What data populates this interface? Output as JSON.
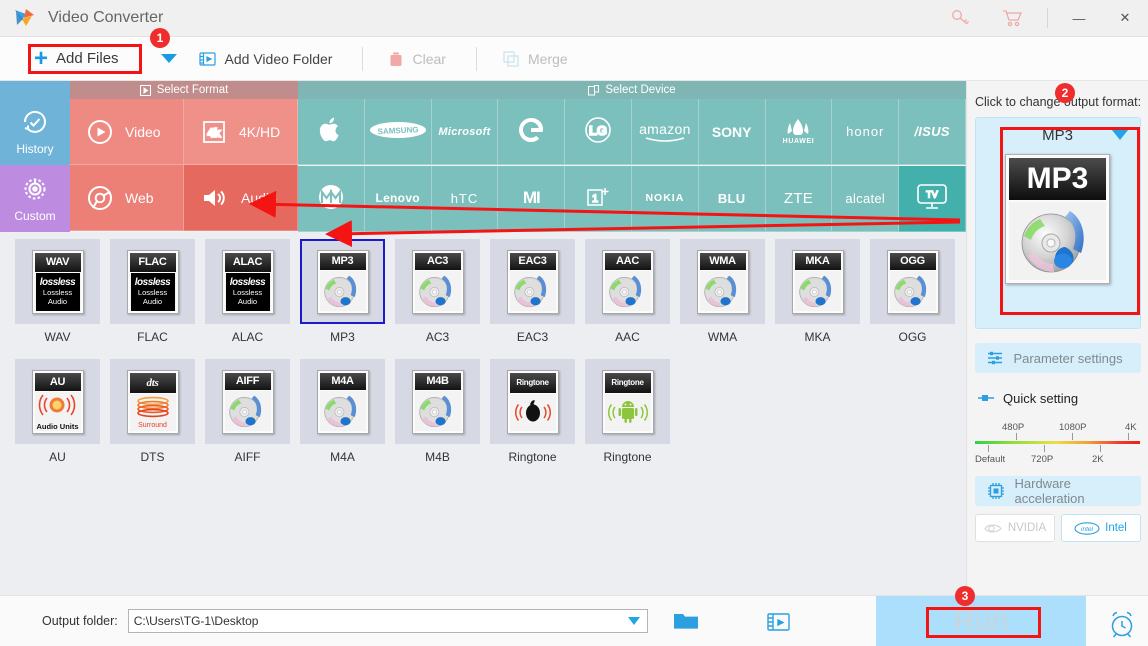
{
  "window": {
    "title": "Video Converter",
    "controls": {
      "key_icon": "key-icon",
      "cart_icon": "cart-icon",
      "minimize": "—",
      "close": "✕"
    }
  },
  "toolbar": {
    "add_files": "Add Files",
    "add_files_dropdown": "chevron-down-icon",
    "add_video_folder": "Add Video Folder",
    "clear": "Clear",
    "merge": "Merge"
  },
  "strips": {
    "select_format": "Select Format",
    "select_device": "Select Device"
  },
  "rail": [
    {
      "label": "History",
      "icon": "history-icon"
    },
    {
      "label": "Custom",
      "icon": "gear-icon"
    }
  ],
  "format_categories": [
    {
      "label": "Video",
      "icon": "play-icon"
    },
    {
      "label": "4K/HD",
      "icon": "4k-icon"
    },
    {
      "label": "Web",
      "icon": "chrome-icon"
    },
    {
      "label": "Audio",
      "icon": "speaker-icon",
      "active": true
    }
  ],
  "devices": [
    {
      "label": "",
      "icon": "apple-icon"
    },
    {
      "label": "SAMSUNG",
      "icon": "samsung-logo"
    },
    {
      "label": "Microsoft",
      "icon": "microsoft-logo"
    },
    {
      "label": "G",
      "icon": "google-logo"
    },
    {
      "label": "LG",
      "icon": "lg-logo"
    },
    {
      "label": "amazon",
      "icon": "amazon-logo"
    },
    {
      "label": "SONY",
      "icon": "sony-logo"
    },
    {
      "label": "HUAWEI",
      "icon": "huawei-logo"
    },
    {
      "label": "honor",
      "icon": "honor-logo"
    },
    {
      "label": "/ISUS",
      "icon": "asus-logo"
    },
    {
      "label": "",
      "icon": "motorola-icon"
    },
    {
      "label": "Lenovo",
      "icon": "lenovo-logo"
    },
    {
      "label": "hTC",
      "icon": "htc-logo"
    },
    {
      "label": "MI",
      "icon": "xiaomi-logo"
    },
    {
      "label": "1+",
      "icon": "oneplus-logo"
    },
    {
      "label": "NOKIA",
      "icon": "nokia-logo"
    },
    {
      "label": "BLU",
      "icon": "blu-logo"
    },
    {
      "label": "ZTE",
      "icon": "zte-logo"
    },
    {
      "label": "alcatel",
      "icon": "alcatel-logo"
    },
    {
      "label": "TV",
      "icon": "tv-icon",
      "active": true
    }
  ],
  "format_tiles": [
    {
      "label": "WAV",
      "badge": "WAV",
      "art": "lossless"
    },
    {
      "label": "FLAC",
      "badge": "FLAC",
      "art": "lossless"
    },
    {
      "label": "ALAC",
      "badge": "ALAC",
      "art": "lossless"
    },
    {
      "label": "MP3",
      "badge": "MP3",
      "art": "disc",
      "selected": true
    },
    {
      "label": "AC3",
      "badge": "AC3",
      "art": "disc"
    },
    {
      "label": "EAC3",
      "badge": "EAC3",
      "art": "disc"
    },
    {
      "label": "AAC",
      "badge": "AAC",
      "art": "disc"
    },
    {
      "label": "WMA",
      "badge": "WMA",
      "art": "disc"
    },
    {
      "label": "MKA",
      "badge": "MKA",
      "art": "disc"
    },
    {
      "label": "OGG",
      "badge": "OGG",
      "art": "disc"
    },
    {
      "label": "AU",
      "badge": "AU",
      "art": "audiounits"
    },
    {
      "label": "DTS",
      "badge": "dts",
      "art": "dts"
    },
    {
      "label": "AIFF",
      "badge": "AIFF",
      "art": "disc"
    },
    {
      "label": "M4A",
      "badge": "M4A",
      "art": "disc"
    },
    {
      "label": "M4B",
      "badge": "M4B",
      "art": "disc"
    },
    {
      "label": "Ringtone",
      "badge": "Ringtone",
      "art": "ringtone-apple"
    },
    {
      "label": "Ringtone",
      "badge": "Ringtone",
      "art": "ringtone-android"
    }
  ],
  "lossless_art": {
    "word": "lossless",
    "line1": "Lossless",
    "line2": "Audio"
  },
  "au_art": {
    "label": "Audio Units"
  },
  "dts_art": {
    "label": "Surround"
  },
  "right_panel": {
    "hint": "Click to change output format:",
    "output_format": "MP3",
    "output_badge": "MP3",
    "parameter_settings": "Parameter settings",
    "quick_setting": "Quick setting",
    "quick_labels_top": [
      "480P",
      "1080P",
      "4K"
    ],
    "quick_labels_bottom": [
      "Default",
      "720P",
      "2K"
    ],
    "hardware_acceleration": "Hardware acceleration",
    "nvidia": "NVIDIA",
    "intel": "Intel"
  },
  "bottom": {
    "output_folder_label": "Output folder:",
    "output_folder_value": "C:\\Users\\TG-1\\Desktop",
    "folder_icon": "open-folder-icon",
    "media_icon": "media-folder-icon",
    "run": "Run",
    "alarm_icon": "alarm-clock-icon"
  },
  "annotations": {
    "badge1": "1",
    "badge2": "2",
    "badge3": "3",
    "accent": "#f41414"
  }
}
